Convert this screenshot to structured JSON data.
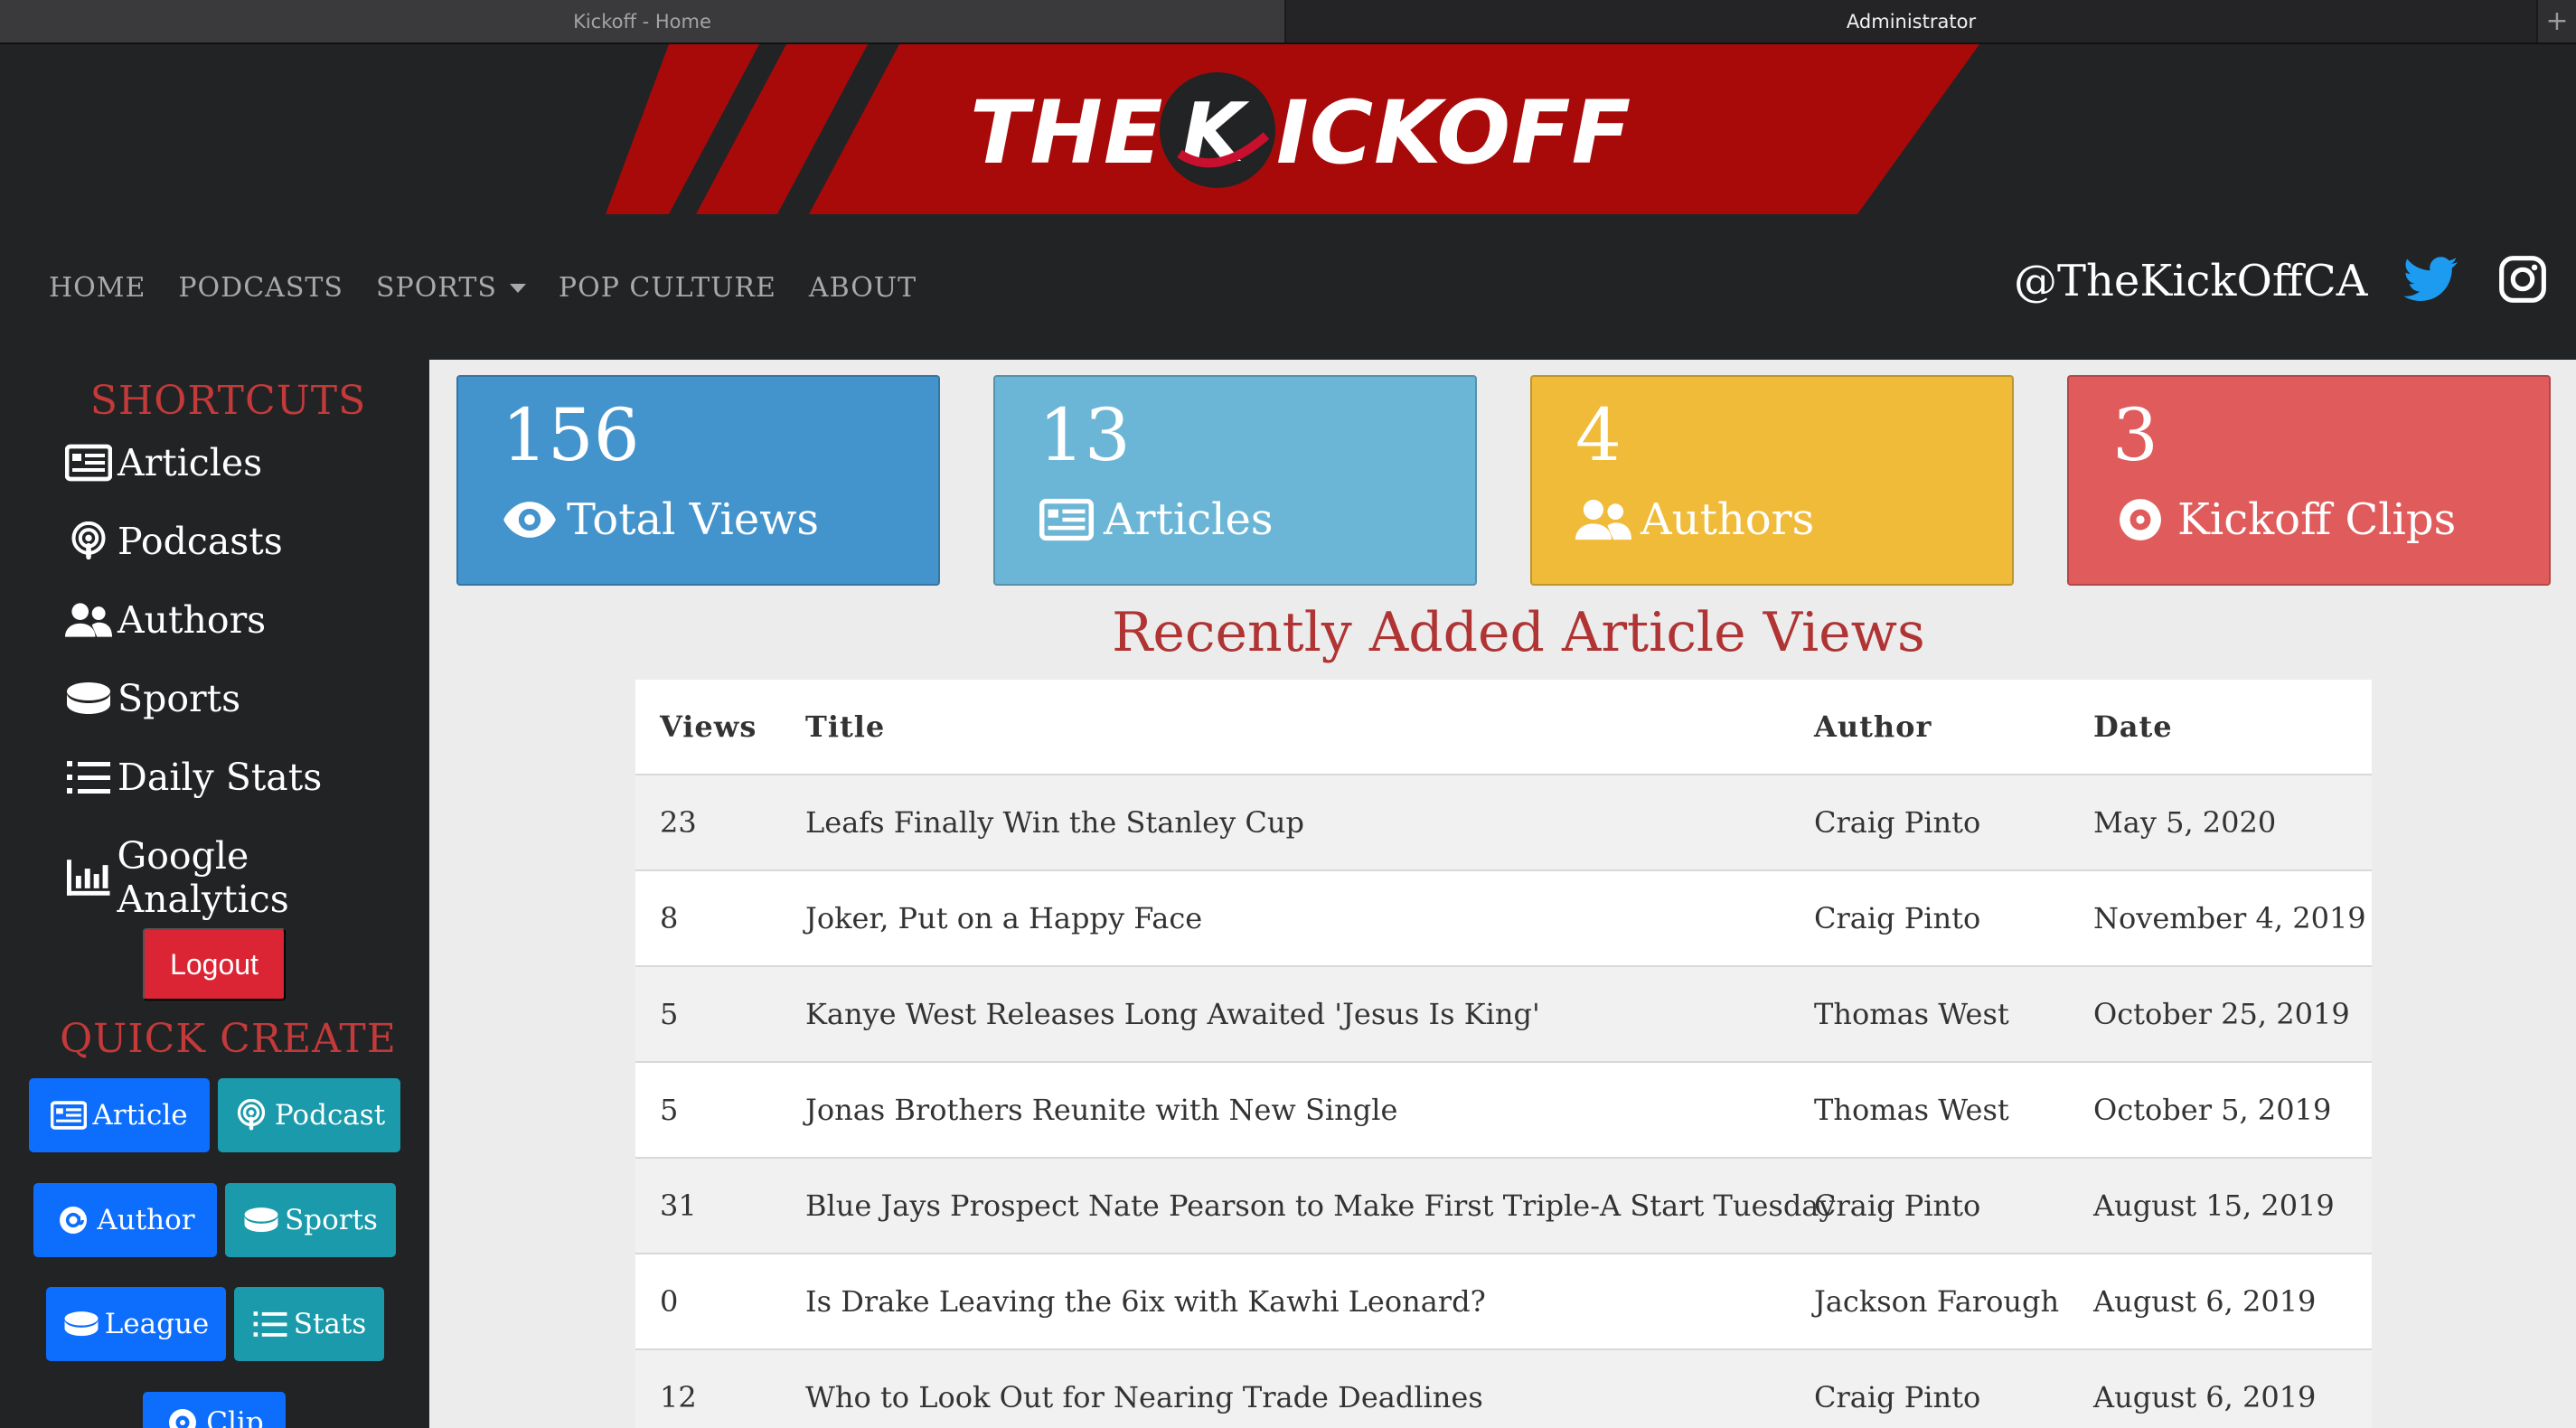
{
  "browser": {
    "tabs": [
      {
        "label": "Kickoff - Home"
      },
      {
        "label": "Administrator"
      }
    ],
    "new_tab_label": "+"
  },
  "brand": {
    "logo_left": "THE",
    "logo_right": "ICKOFF",
    "primary_color": "#a80a0a",
    "accent_color": "#c23a3a"
  },
  "nav": {
    "items": [
      "HOME",
      "PODCASTS",
      "SPORTS",
      "POP CULTURE",
      "ABOUT"
    ],
    "social_handle": "@TheKickOffCA",
    "icons": [
      "twitter-icon",
      "instagram-icon"
    ]
  },
  "sidebar": {
    "shortcuts_title": "SHORTCUTS",
    "shortcuts": [
      {
        "label": "Articles",
        "icon": "newspaper-icon"
      },
      {
        "label": "Podcasts",
        "icon": "podcast-icon"
      },
      {
        "label": "Authors",
        "icon": "users-icon"
      },
      {
        "label": "Sports",
        "icon": "hockey-puck-icon"
      },
      {
        "label": "Daily Stats",
        "icon": "list-icon"
      },
      {
        "label": "Google Analytics",
        "icon": "chart-bar-icon"
      }
    ],
    "logout_label": "Logout",
    "quick_create_title": "QUICK CREATE",
    "quick_create": [
      {
        "label": "Article",
        "icon": "newspaper-icon",
        "color": "#0d6efd"
      },
      {
        "label": "Podcast",
        "icon": "podcast-icon",
        "color": "#1a9aaa"
      },
      {
        "label": "Author",
        "icon": "at-icon",
        "color": "#0d6efd"
      },
      {
        "label": "Sports",
        "icon": "hockey-puck-icon",
        "color": "#1a9aaa"
      },
      {
        "label": "League",
        "icon": "hockey-puck-icon",
        "color": "#0d6efd"
      },
      {
        "label": "Stats",
        "icon": "list-icon",
        "color": "#1a9aaa"
      },
      {
        "label": "Clip",
        "icon": "record-icon",
        "color": "#0d6efd"
      }
    ]
  },
  "stats": [
    {
      "value": "156",
      "label": "Total Views",
      "icon": "eye-icon",
      "color": "#4393cc"
    },
    {
      "value": "13",
      "label": "Articles",
      "icon": "newspaper-icon",
      "color": "#6bb6d6"
    },
    {
      "value": "4",
      "label": "Authors",
      "icon": "users-icon",
      "color": "#f0bb38"
    },
    {
      "value": "3",
      "label": "Kickoff Clips",
      "icon": "record-icon",
      "color": "#e05b5b"
    }
  ],
  "recent": {
    "title": "Recently Added Article Views",
    "columns": [
      "Views",
      "Title",
      "Author",
      "Date"
    ],
    "rows": [
      {
        "views": "23",
        "title": "Leafs Finally Win the Stanley Cup",
        "author": "Craig Pinto",
        "date": "May 5, 2020"
      },
      {
        "views": "8",
        "title": "Joker, Put on a Happy Face",
        "author": "Craig Pinto",
        "date": "November 4, 2019"
      },
      {
        "views": "5",
        "title": "Kanye West Releases Long Awaited 'Jesus Is King'",
        "author": "Thomas West",
        "date": "October 25, 2019"
      },
      {
        "views": "5",
        "title": "Jonas Brothers Reunite with New Single",
        "author": "Thomas West",
        "date": "October 5, 2019"
      },
      {
        "views": "31",
        "title": "Blue Jays Prospect Nate Pearson to Make First Triple-A Start Tuesday",
        "author": "Craig Pinto",
        "date": "August 15, 2019"
      },
      {
        "views": "0",
        "title": "Is Drake Leaving the 6ix with Kawhi Leonard?",
        "author": "Jackson Farough",
        "date": "August 6, 2019"
      },
      {
        "views": "12",
        "title": "Who to Look Out for Nearing Trade Deadlines",
        "author": "Craig Pinto",
        "date": "August 6, 2019"
      }
    ]
  }
}
